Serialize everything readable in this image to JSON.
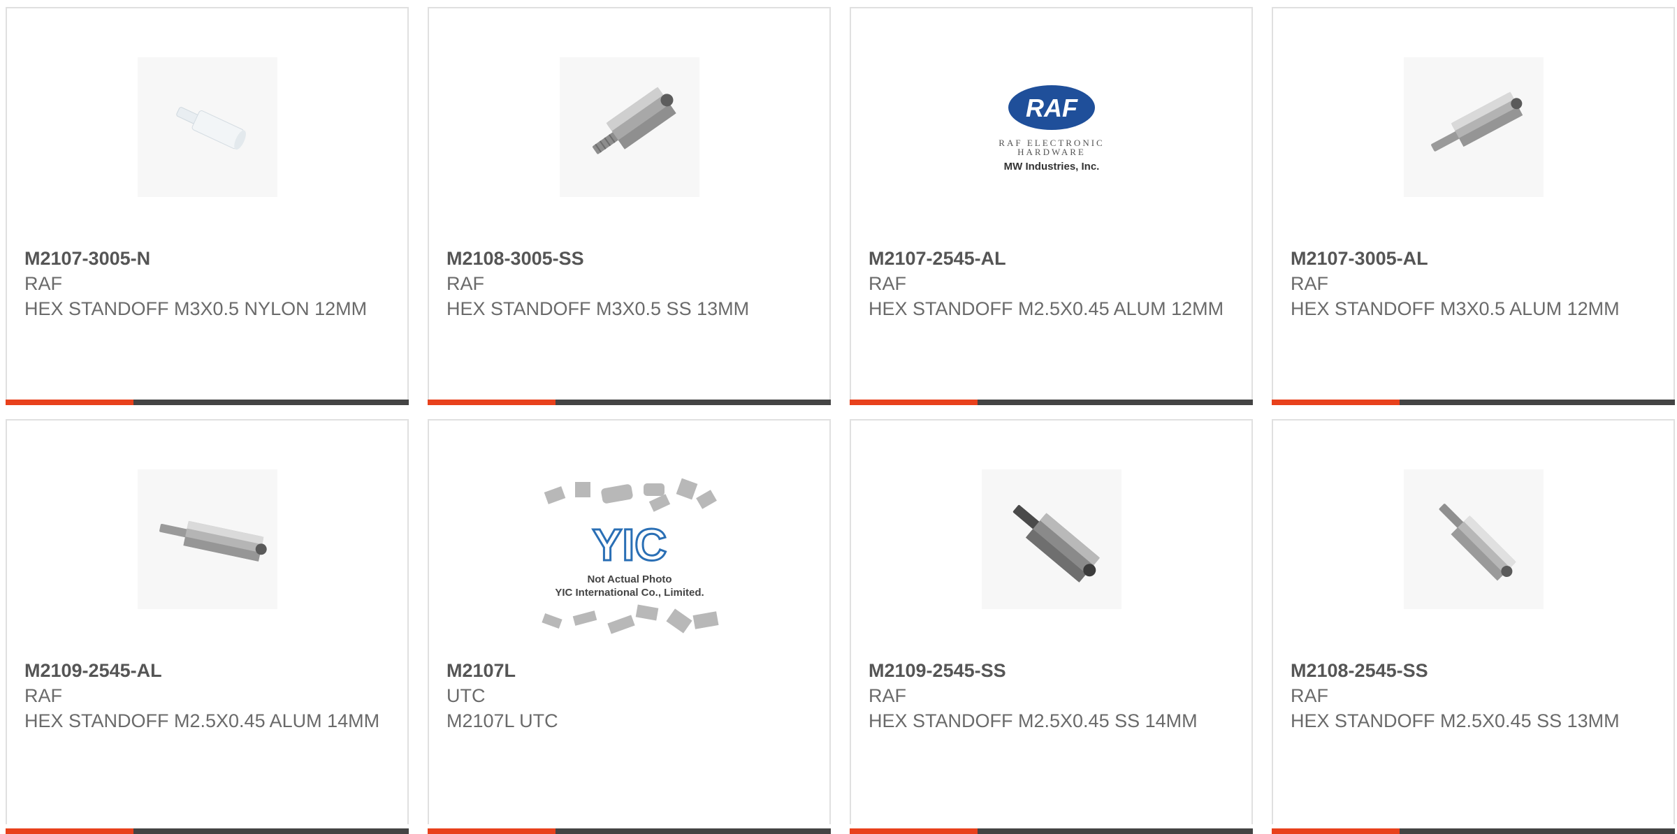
{
  "products": [
    {
      "part": "M2107-3005-N",
      "maker": "RAF",
      "description": "HEX STANDOFF M3X0.5 NYLON 12MM",
      "image": "nylon-standoff-icon"
    },
    {
      "part": "M2108-3005-SS",
      "maker": "RAF",
      "description": "HEX STANDOFF M3X0.5 SS 13MM",
      "image": "steel-standoff-icon"
    },
    {
      "part": "M2107-2545-AL",
      "maker": "RAF",
      "description": "HEX STANDOFF M2.5X0.45 ALUM 12MM",
      "image": "raf-logo",
      "logo": {
        "mark": "RAF",
        "line1": "RAF ELECTRONIC",
        "line2": "HARDWARE",
        "line3": "MW Industries, Inc."
      }
    },
    {
      "part": "M2107-3005-AL",
      "maker": "RAF",
      "description": "HEX STANDOFF M3X0.5 ALUM 12MM",
      "image": "alum-standoff-icon"
    },
    {
      "part": "M2109-2545-AL",
      "maker": "RAF",
      "description": "HEX STANDOFF M2.5X0.45 ALUM 14MM",
      "image": "alum-standoff-icon"
    },
    {
      "part": "M2107L",
      "maker": "UTC",
      "description": "M2107L UTC",
      "image": "yic-placeholder",
      "logo": {
        "mark": "YIC",
        "line1": "Not Actual Photo",
        "line2": "YIC International Co., Limited."
      }
    },
    {
      "part": "M2109-2545-SS",
      "maker": "RAF",
      "description": "HEX STANDOFF M2.5X0.45 SS 14MM",
      "image": "steel-standoff-icon"
    },
    {
      "part": "M2108-2545-SS",
      "maker": "RAF",
      "description": "HEX STANDOFF M2.5X0.45 SS 13MM",
      "image": "steel-standoff-icon"
    }
  ],
  "colors": {
    "accent": "#e8411c",
    "bar": "#444444",
    "text": "#6a6a6a",
    "border": "#e0e0e0"
  }
}
